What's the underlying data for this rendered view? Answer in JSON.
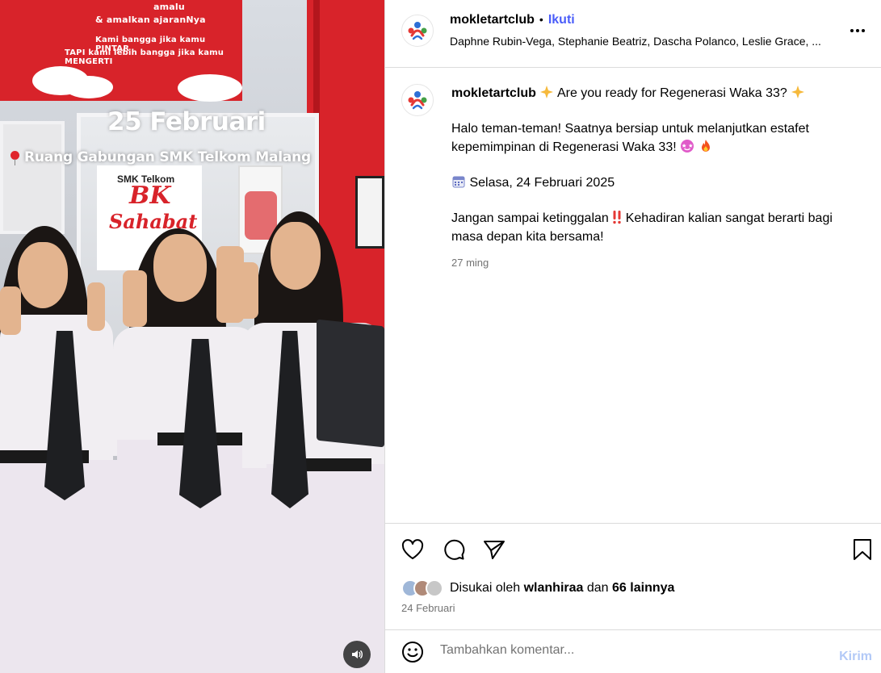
{
  "media": {
    "banner_lines": [
      "amalu",
      "& amalkan ajaranNya",
      "Kami bangga jika kamu PINTAR",
      "TAPI kami lebih bangga jika kamu MENGERTI"
    ],
    "overlay_date": "25 Februari",
    "overlay_location": "Ruang Gabungan SMK Telkom Malang",
    "poster_bk": "BK",
    "poster_sahabat": "Sahabat",
    "poster_header": "SMK Telkom",
    "volume_icon": "speaker-icon"
  },
  "header": {
    "username": "mokletartclub",
    "separator": "•",
    "follow_label": "Ikuti",
    "audio_text": "Daphne Rubin-Vega, Stephanie Beatriz, Dascha Polanco, Leslie Grace, ...",
    "more_icon": "more-options-icon"
  },
  "caption": {
    "username": "mokletartclub",
    "title": "Are you ready for Regenerasi Waka 33?",
    "paragraph1": "Halo teman-teman! Saatnya bersiap untuk melanjutkan estafet kepemimpinan di Regenerasi Waka 33!",
    "date_line": "Selasa, 24 Februari 2025",
    "paragraph3a": "Jangan sampai ketinggalan",
    "paragraph3b": "Kehadiran kalian sangat berarti bagi masa depan kita bersama!",
    "time_ago": "27 ming"
  },
  "actions": {
    "like_icon": "heart-icon",
    "comment_icon": "comment-icon",
    "share_icon": "send-icon",
    "save_icon": "bookmark-icon"
  },
  "likes": {
    "prefix": "Disukai oleh",
    "user": "wlanhiraa",
    "connector": "dan",
    "others": "66 lainnya"
  },
  "post_date": "24 Februari",
  "comment": {
    "placeholder": "Tambahkan komentar...",
    "send_label": "Kirim",
    "emoji_icon": "smiley-icon"
  },
  "colors": {
    "link_blue": "#4a5df9",
    "send_disabled": "#b2c9f7",
    "meta_gray": "#737373",
    "border": "#dbdbdb",
    "media_red": "#d8232a"
  }
}
